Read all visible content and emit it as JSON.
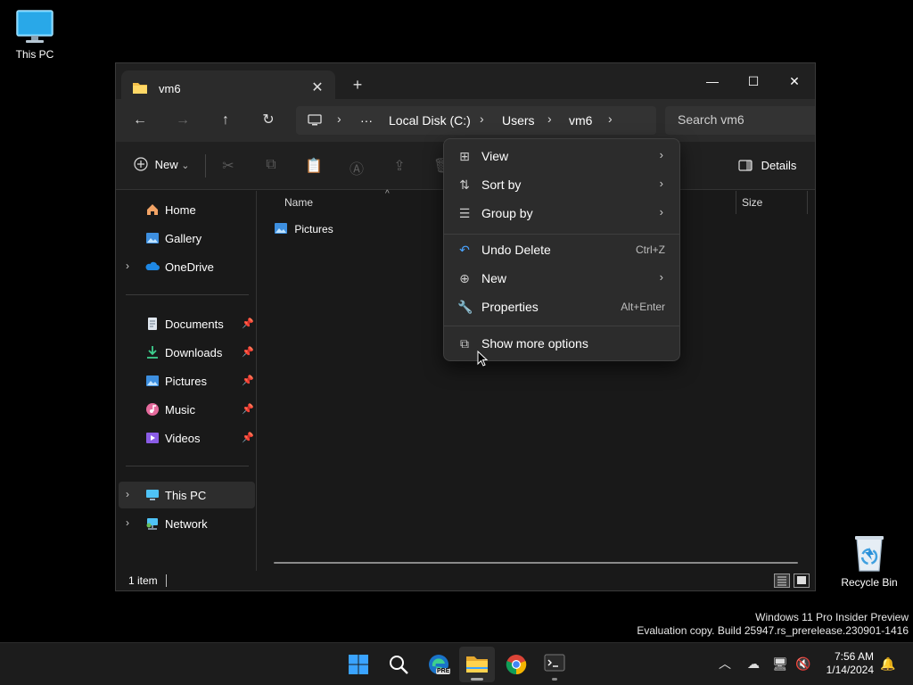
{
  "desktop": {
    "this_pc_label": "This PC",
    "recycle_bin_label": "Recycle Bin",
    "watermark_line1": "Windows 11 Pro Insider Preview",
    "watermark_line2": "Evaluation copy. Build 25947.rs_prerelease.230901-1416"
  },
  "explorer": {
    "tab_title": "vm6",
    "new_tab_glyph": "+",
    "tab_close_glyph": "✕",
    "window_controls": {
      "minimize": "—",
      "maximize": "☐",
      "close": "✕"
    },
    "nav": {
      "back": "←",
      "forward": "→",
      "up": "↑",
      "refresh": "↻"
    },
    "breadcrumb": {
      "more": "···",
      "items": [
        "Local Disk (C:)",
        "Users",
        "vm6"
      ],
      "sep": "›"
    },
    "search_placeholder": "Search vm6",
    "toolbar": {
      "new_label": "New",
      "new_caret": "⌄",
      "details_label": "Details"
    },
    "sidebar": {
      "home": "Home",
      "gallery": "Gallery",
      "onedrive": "OneDrive",
      "documents": "Documents",
      "downloads": "Downloads",
      "pictures": "Pictures",
      "music": "Music",
      "videos": "Videos",
      "this_pc": "This PC",
      "network": "Network",
      "expand_glyph": "›",
      "pin_glyph": "📌"
    },
    "columns": {
      "name": "Name",
      "size": "Size"
    },
    "files": [
      {
        "name": "Pictures"
      }
    ],
    "status": {
      "item_count": "1 item"
    }
  },
  "context_menu": {
    "items": [
      {
        "label": "View",
        "has_submenu": true
      },
      {
        "label": "Sort by",
        "has_submenu": true
      },
      {
        "label": "Group by",
        "has_submenu": true
      },
      {
        "label": "Undo Delete",
        "accelerator": "Ctrl+Z"
      },
      {
        "label": "New",
        "has_submenu": true
      },
      {
        "label": "Properties",
        "accelerator": "Alt+Enter"
      },
      {
        "label": "Show more options"
      }
    ],
    "submenu_glyph": "›"
  },
  "taskbar": {
    "time": "7:56 AM",
    "date": "1/14/2024",
    "apps": [
      "Start",
      "Search",
      "Microsoft Edge",
      "File Explorer",
      "Google Chrome",
      "Terminal"
    ],
    "edge_badge": "PRE"
  },
  "colors": {
    "accent_blue": "#2d8cf0",
    "folder_yellow": "#f4c04a",
    "menu_bg": "#2c2c2c",
    "window_bg": "#191919"
  }
}
